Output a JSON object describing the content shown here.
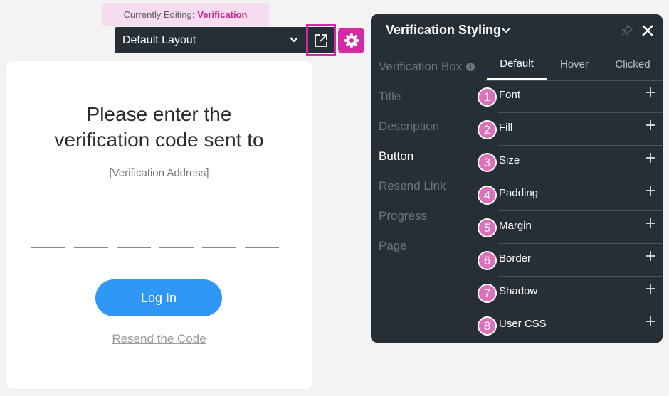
{
  "editing": {
    "prefix": "Currently Editing:",
    "target": "Verification"
  },
  "layout_select": {
    "value": "Default Layout"
  },
  "card": {
    "title_line1": "Please enter the",
    "title_line2": "verification code sent to",
    "address": "[Verification Address]",
    "code_slot_count": 6,
    "login_label": "Log In",
    "resend_label": "Resend the Code"
  },
  "panel": {
    "title": "Verification Styling",
    "nav": [
      {
        "label": "Verification Box",
        "active": false
      },
      {
        "label": "Title",
        "active": false
      },
      {
        "label": "Description",
        "active": false
      },
      {
        "label": "Button",
        "active": true
      },
      {
        "label": "Resend Link",
        "active": false
      },
      {
        "label": "Progress",
        "active": false
      },
      {
        "label": "Page",
        "active": false
      }
    ],
    "info_glyph": "i",
    "tabs": [
      {
        "label": "Default",
        "active": true
      },
      {
        "label": "Hover",
        "active": false
      },
      {
        "label": "Clicked",
        "active": false
      }
    ],
    "properties": [
      {
        "badge": "1",
        "label": "Font"
      },
      {
        "badge": "2",
        "label": "Fill"
      },
      {
        "badge": "3",
        "label": "Size"
      },
      {
        "badge": "4",
        "label": "Padding"
      },
      {
        "badge": "5",
        "label": "Margin"
      },
      {
        "badge": "6",
        "label": "Border"
      },
      {
        "badge": "7",
        "label": "Shadow"
      },
      {
        "badge": "8",
        "label": "User CSS"
      }
    ]
  },
  "colors": {
    "accent": "#d42ba5",
    "panel_bg": "#272f36",
    "primary_button": "#2f97f5",
    "badge": "#dc70bb"
  },
  "icons": {
    "layout_chevron": "chevron-down-icon",
    "open_external": "external-link-icon",
    "settings": "gear-icon",
    "pin": "pin-icon",
    "close": "close-icon",
    "add": "plus-icon"
  }
}
